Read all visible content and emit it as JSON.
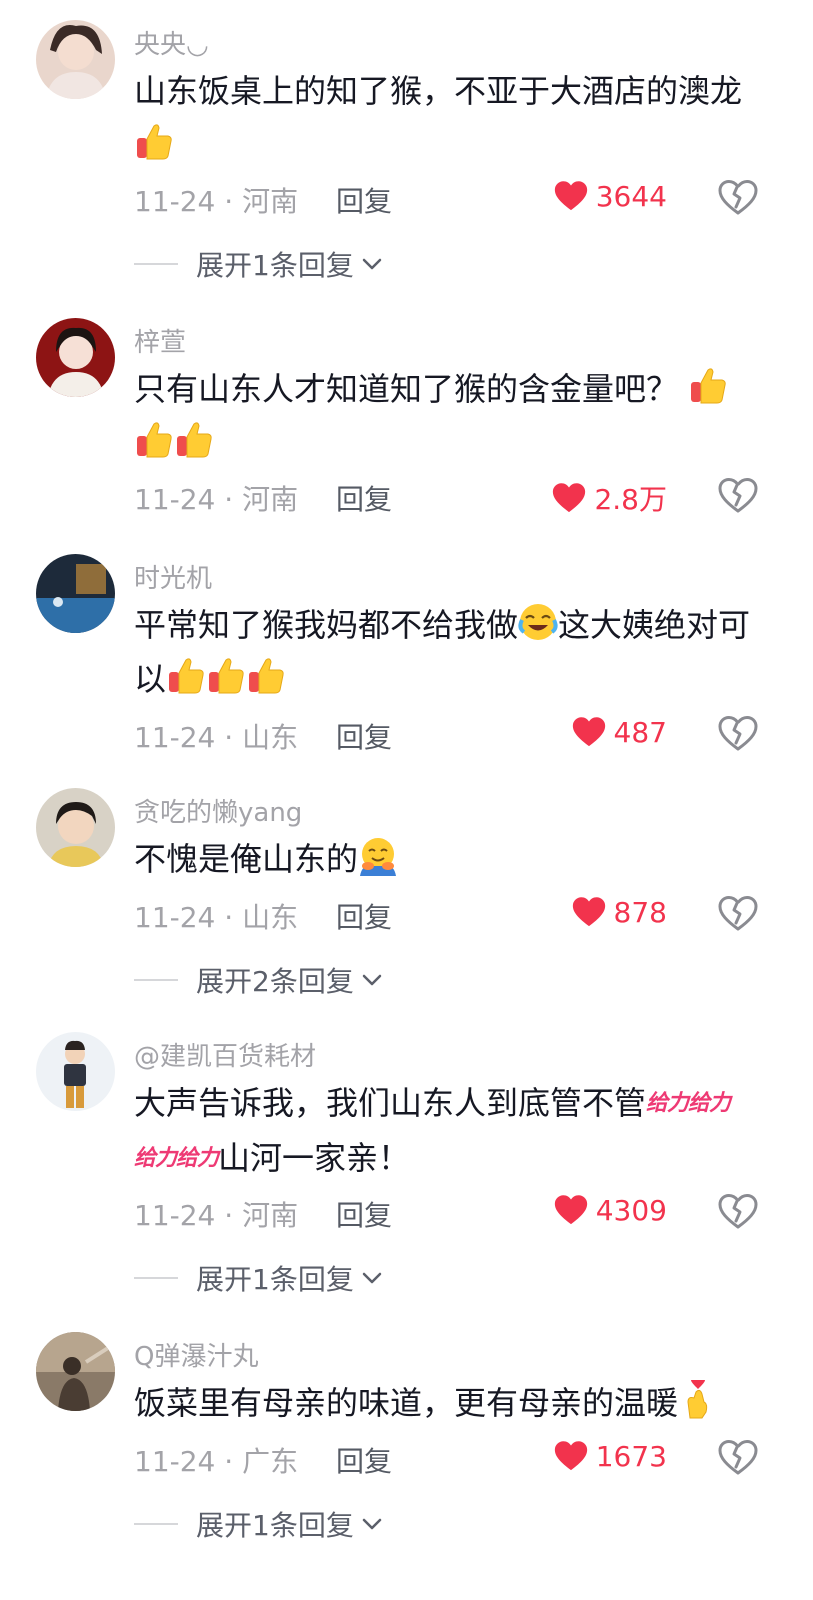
{
  "comments": [
    {
      "username": "央央◡",
      "text_parts": [
        "山东饭桌上的知了猴，不亚于大酒店的澳龙"
      ],
      "date_location": "11-24 · 河南",
      "reply_label": "回复",
      "likes": "3644",
      "expand_label": "展开1条回复"
    },
    {
      "username": "梓萱",
      "text_parts": [
        "只有山东人才知道知了猴的含金量吧？"
      ],
      "date_location": "11-24 · 河南",
      "reply_label": "回复",
      "likes": "2.8万"
    },
    {
      "username": "时光机",
      "text_parts": [
        "平常知了猴我妈都不给我做",
        "这大姨绝对可以"
      ],
      "date_location": "11-24 · 山东",
      "reply_label": "回复",
      "likes": "487"
    },
    {
      "username": "贪吃的懒yang",
      "text_parts": [
        "不愧是俺山东的"
      ],
      "date_location": "11-24 · 山东",
      "reply_label": "回复",
      "likes": "878",
      "expand_label": "展开2条回复"
    },
    {
      "username": "@建凯百货耗材",
      "text_parts": [
        "大声告诉我，我们山东人到底管不管",
        "给力",
        "给力",
        "给力",
        "给力",
        "山河一家亲！"
      ],
      "date_location": "11-24 · 河南",
      "reply_label": "回复",
      "likes": "4309",
      "expand_label": "展开1条回复"
    },
    {
      "username": "Q弹瀑汁丸",
      "text_parts": [
        "饭菜里有母亲的味道，更有母亲的温暖"
      ],
      "date_location": "11-24 · 广东",
      "reply_label": "回复",
      "likes": "1673",
      "expand_label": "展开1条回复"
    }
  ],
  "icons": {
    "like": "heart-icon",
    "dislike": "broken-heart-icon",
    "expand": "chevron-down-icon"
  },
  "colors": {
    "like_red": "#f2334d",
    "username_gray": "#a3a3a8",
    "text_dark": "#161823",
    "geili_pink": "#ee3a74"
  }
}
